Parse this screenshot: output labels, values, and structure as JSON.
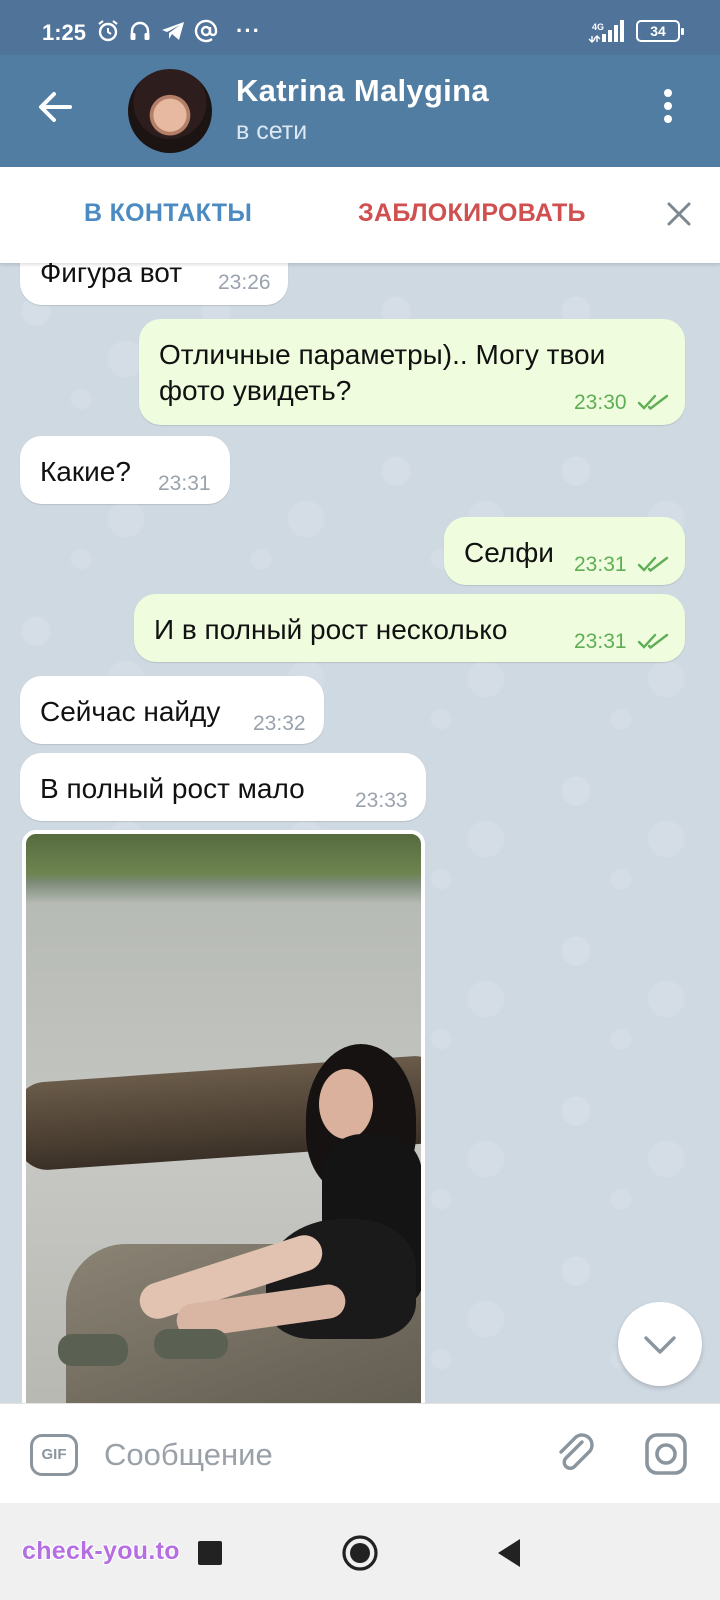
{
  "status_bar": {
    "time": "1:25",
    "network": "4G",
    "battery": "34",
    "more_indicator": "···"
  },
  "header": {
    "contact_name": "Katrina Malygina",
    "contact_status": "в сети"
  },
  "action_bar": {
    "add_contact": "В КОНТАКТЫ",
    "block": "ЗАБЛОКИРОВАТЬ"
  },
  "messages": [
    {
      "direction": "in",
      "text": "Фигура вот",
      "time": "23:26"
    },
    {
      "direction": "out",
      "text_line1": "Отличные параметры).. Могу твои",
      "text_line2": "фото увидеть?",
      "time": "23:30"
    },
    {
      "direction": "in",
      "text": "Какие?",
      "time": "23:31"
    },
    {
      "direction": "out",
      "text": "Селфи",
      "time": "23:31"
    },
    {
      "direction": "out",
      "text": "И в полный рост несколько",
      "time": "23:31"
    },
    {
      "direction": "in",
      "text": "Сейчас найду",
      "time": "23:32"
    },
    {
      "direction": "in",
      "text": "В полный рост мало",
      "time": "23:33"
    }
  ],
  "input": {
    "gif_label": "GIF",
    "placeholder": "Сообщение"
  },
  "watermark": "check-you.to",
  "colors": {
    "header": "#527da3",
    "outgoing_bubble": "#effdde",
    "incoming_bubble": "#ffffff",
    "add_contact": "#4c8bc1",
    "block": "#d05050",
    "read_checks": "#5fae56"
  },
  "icons": {
    "back": "arrow-left-icon",
    "menu": "more-vertical-icon",
    "close": "close-icon",
    "scroll": "chevron-down-icon",
    "attach": "paperclip-icon",
    "camera": "camera-icon",
    "status_alarm": "alarm-icon",
    "status_headphones": "headphones-icon",
    "status_telegram": "telegram-icon",
    "status_at": "at-icon"
  }
}
